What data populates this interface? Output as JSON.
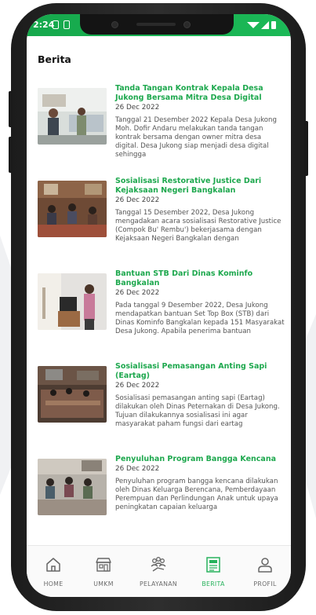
{
  "status_bar": {
    "time": "2:24"
  },
  "page": {
    "title": "Berita"
  },
  "news": [
    {
      "title": "Tanda Tangan Kontrak Kepala Desa Jukong Bersama Mitra Desa Digital",
      "date": "26 Dec 2022",
      "excerpt": "Tanggal 21 Desember 2022 Kepala Desa Jukong Moh. Dofir Andaru melakukan tanda tangan kontrak bersama dengan owner mitra desa digital. Desa Jukong siap menjadi desa digital sehingga"
    },
    {
      "title": "Sosialisasi Restorative Justice Dari Kejaksaan Negeri Bangkalan",
      "date": "26 Dec 2022",
      "excerpt": "Tanggal 15 Desember 2022, Desa Jukong mengadakan acara sosialisasi Restorative Justice (Compok Bu' Rembu') bekerjasama dengan Kejaksaan Negeri Bangkalan dengan"
    },
    {
      "title": "Bantuan STB Dari Dinas Kominfo Bangkalan",
      "date": "26 Dec 2022",
      "excerpt": "Pada tanggal 9 Desember 2022, Desa Jukong mendapatkan bantuan Set Top Box (STB) dari Dinas Kominfo Bangkalan kepada 151 Masyarakat Desa Jukong. Apabila penerima bantuan"
    },
    {
      "title": "Sosialisasi Pemasangan Anting Sapi (Eartag)",
      "date": "26 Dec 2022",
      "excerpt": "Sosialisasi pemasangan anting sapi (Eartag) dilakukan oleh Dinas Peternakan di Desa Jukong. Tujuan dilakukannya sosialisasi ini agar masyarakat paham fungsi dari eartag"
    },
    {
      "title": "Penyuluhan Program Bangga Kencana",
      "date": "26 Dec 2022",
      "excerpt": "Penyuluhan program bangga kencana dilakukan oleh Dinas Keluarga Berencana, Pemberdayaan Perempuan dan Perlindungan Anak untuk upaya peningkatan capaian keluarga"
    }
  ],
  "bottom_nav": [
    {
      "label": "HOME",
      "icon": "home-icon"
    },
    {
      "label": "UMKM",
      "icon": "store-icon"
    },
    {
      "label": "PELAYANAN",
      "icon": "people-icon"
    },
    {
      "label": "BERITA",
      "icon": "newspaper-icon",
      "active": true
    },
    {
      "label": "PROFIL",
      "icon": "user-icon"
    }
  ],
  "colors": {
    "accent": "#1ea84e",
    "status_bar": "#1bb957",
    "active_nav": "#27b25c",
    "inactive_nav": "#6b6b6b"
  }
}
